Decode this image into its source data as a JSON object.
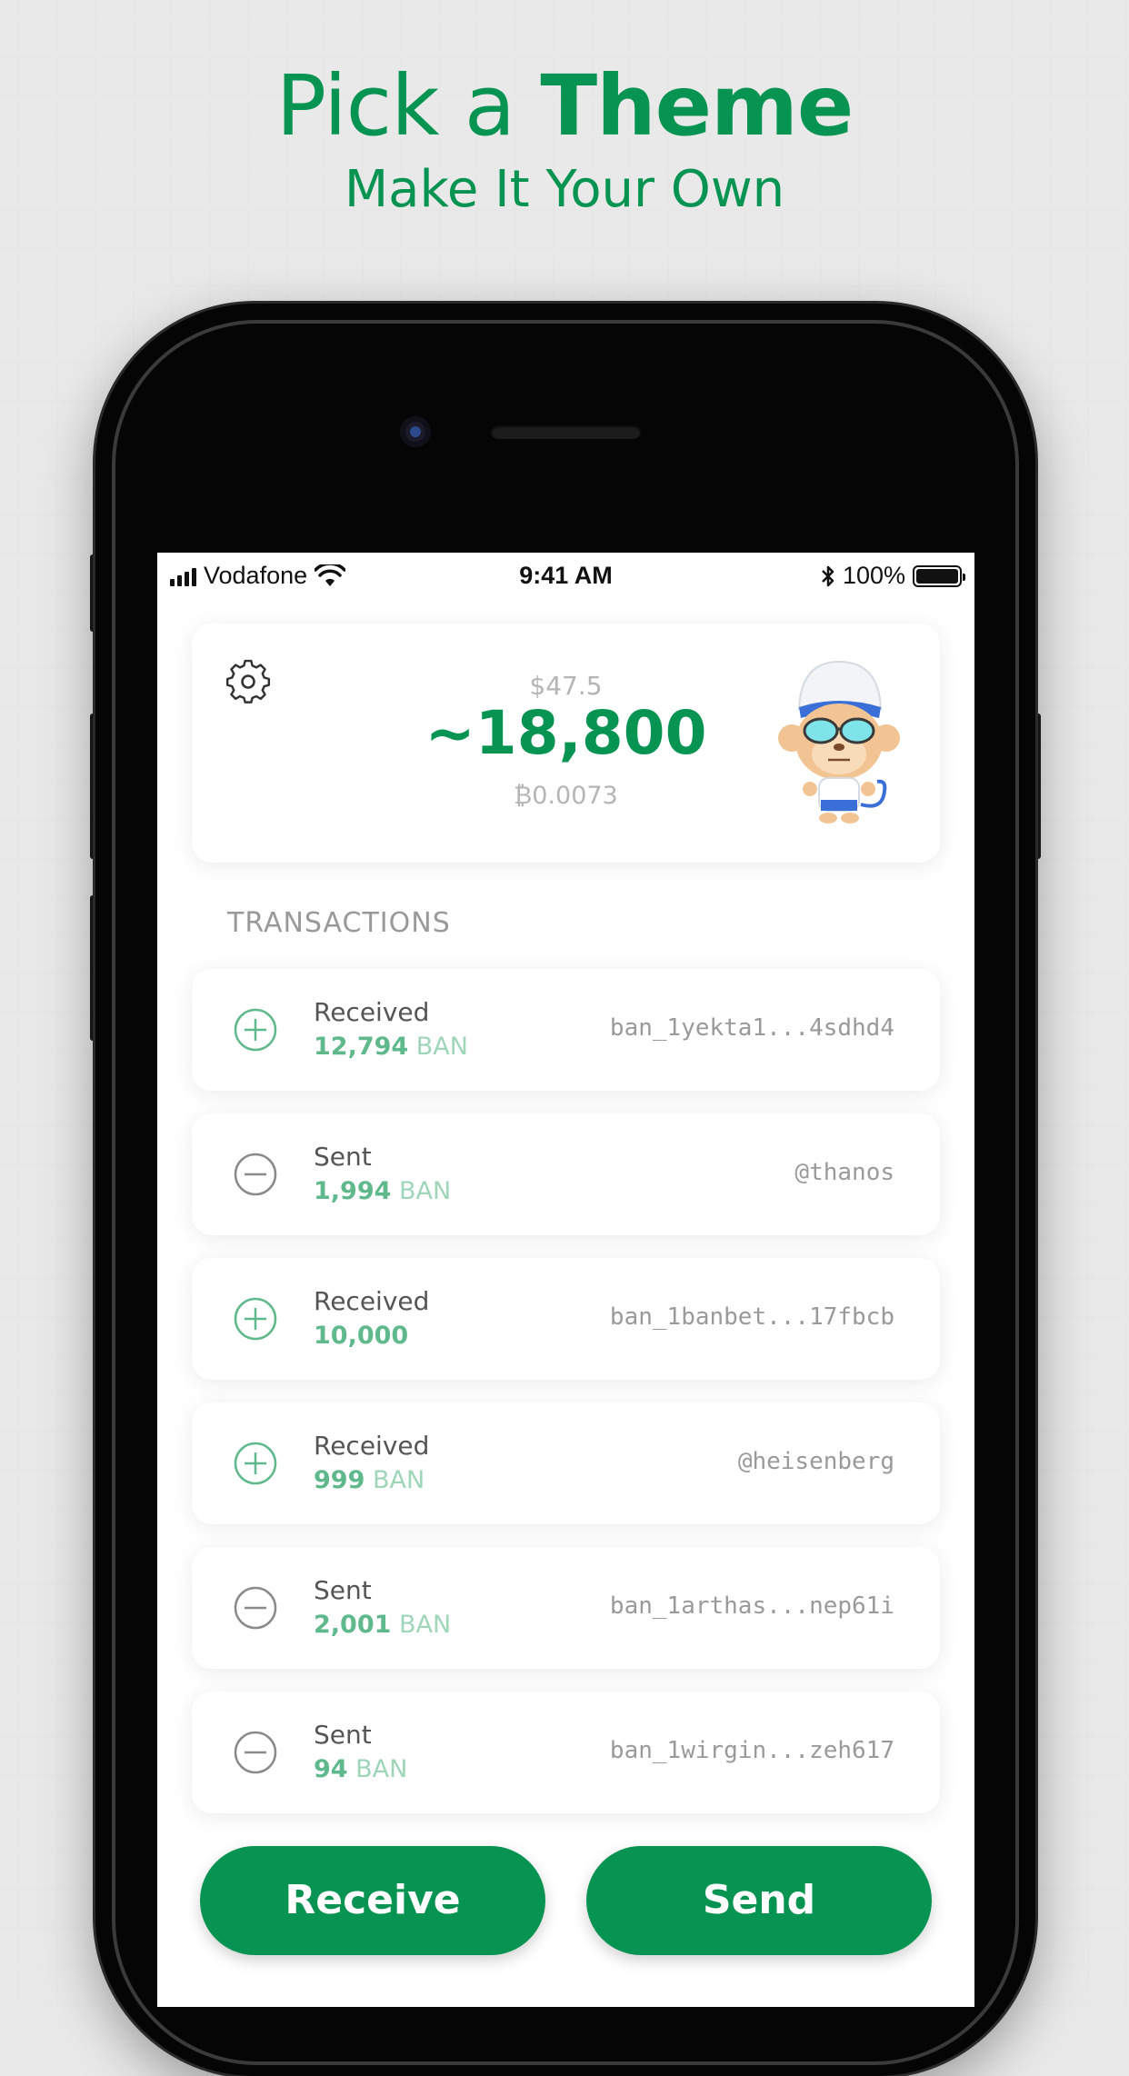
{
  "header": {
    "title_light": "Pick a ",
    "title_bold": "Theme",
    "subtitle": "Make It Your Own"
  },
  "statusbar": {
    "carrier": "Vodafone",
    "time": "9:41 AM",
    "battery": "100%"
  },
  "balance": {
    "fiat": "$47.5",
    "amount": "~18,800",
    "btc": "₿0.0073"
  },
  "transactions": {
    "heading": "TRANSACTIONS",
    "items": [
      {
        "type": "Received",
        "amount": "12,794",
        "unit": " BAN",
        "address": "ban_1yekta1...4sdhd4",
        "icon": "plus-circle-icon"
      },
      {
        "type": "Sent",
        "amount": "1,994",
        "unit": " BAN",
        "address": "@thanos",
        "icon": "minus-circle-icon"
      },
      {
        "type": "Received",
        "amount": "10,000",
        "unit": "",
        "address": "ban_1banbet...17fbcb",
        "icon": "plus-circle-icon"
      },
      {
        "type": "Received",
        "amount": "999",
        "unit": " BAN",
        "address": "@heisenberg",
        "icon": "plus-circle-icon"
      },
      {
        "type": "Sent",
        "amount": "2,001",
        "unit": " BAN",
        "address": "ban_1arthas...nep61i",
        "icon": "minus-circle-icon"
      },
      {
        "type": "Sent",
        "amount": "94",
        "unit": " BAN",
        "address": "ban_1wirgin...zeh617",
        "icon": "minus-circle-icon"
      }
    ]
  },
  "actions": {
    "receive": "Receive",
    "send": "Send"
  },
  "colors": {
    "accent": "#079452",
    "amount_green": "#5fb98c"
  }
}
